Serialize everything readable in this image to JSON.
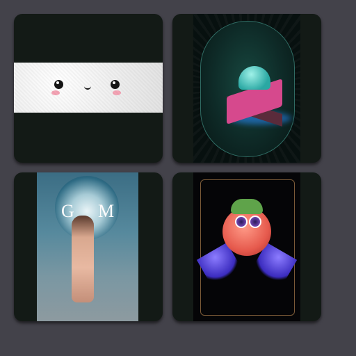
{
  "gallery": {
    "cards": [
      {
        "id": "card-1"
      },
      {
        "id": "card-2"
      },
      {
        "id": "card-3",
        "monogram_left": "G",
        "monogram_right": "M"
      },
      {
        "id": "card-4"
      }
    ]
  },
  "colors": {
    "page_background": "#43424a",
    "card_background": "#131a16",
    "banner": "#eeeeee",
    "blush": "#f4a3b4"
  }
}
